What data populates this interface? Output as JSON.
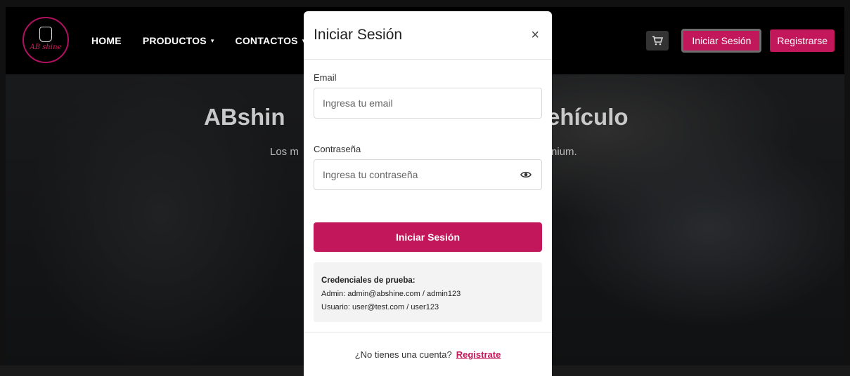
{
  "navbar": {
    "logo_text": "AB shine",
    "links": [
      {
        "label": "HOME",
        "dropdown": false
      },
      {
        "label": "PRODUCTOS",
        "dropdown": true
      },
      {
        "label": "CONTACTOS",
        "dropdown": true
      }
    ],
    "caret": "▾",
    "cart_icon": "cart-icon",
    "login_label": "Iniciar Sesión",
    "register_label": "Registrarse"
  },
  "hero": {
    "title_left_visible": "ABshin",
    "title_right_visible": "ehículo",
    "subtitle_left_visible": "Los m",
    "subtitle_right_visible": "nium."
  },
  "modal": {
    "title": "Iniciar Sesión",
    "close_symbol": "×",
    "email_label": "Email",
    "email_placeholder": "Ingresa tu email",
    "password_label": "Contraseña",
    "password_placeholder": "Ingresa tu contraseña",
    "submit_label": "Iniciar Sesión",
    "credentials": {
      "title": "Credenciales de prueba:",
      "admin": "Admin: admin@abshine.com / admin123",
      "user": "Usuario: user@test.com / user123"
    },
    "footer_text": "¿No tienes una cuenta?",
    "footer_link": "Registrate"
  },
  "colors": {
    "accent": "#c2185b",
    "navbar_bg": "#000000",
    "modal_bg": "#ffffff"
  }
}
